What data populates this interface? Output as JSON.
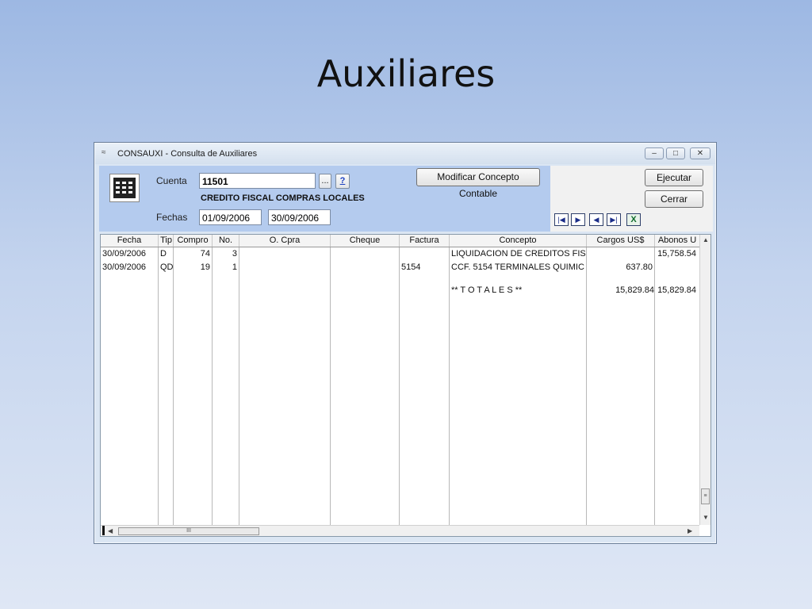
{
  "slide": {
    "title": "Auxiliares"
  },
  "window": {
    "title": "CONSAUXI - Consulta de Auxiliares",
    "controls": {
      "minimize": "–",
      "maximize": "□",
      "close": "✕"
    }
  },
  "form": {
    "cuenta_label": "Cuenta",
    "cuenta_value": "11501",
    "browse_label": "...",
    "help_label": "?",
    "cuenta_description": "CREDITO FISCAL COMPRAS LOCALES",
    "fechas_label": "Fechas",
    "fecha_desde": "01/09/2006",
    "fecha_hasta": "30/09/2006",
    "modificar_label": "Modificar Concepto Contable",
    "ejecutar_label": "Ejecutar",
    "cerrar_label": "Cerrar"
  },
  "nav": {
    "first": "|◀",
    "next": "▶",
    "prev": "◀",
    "last": "▶|",
    "excel": "X"
  },
  "table": {
    "headers": [
      "Fecha",
      "Tip",
      "Compro",
      "No.",
      "O. Cpra",
      "Cheque",
      "Factura",
      "Concepto",
      "Cargos US$",
      "Abonos U"
    ],
    "rows": [
      [
        "30/09/2006",
        "D",
        "74",
        "3",
        "",
        "",
        "",
        "LIQUIDACION DE CREDITOS FIS",
        "",
        "15,758.54"
      ],
      [
        "30/09/2006",
        "QD",
        "19",
        "1",
        "",
        "",
        "5154",
        "CCF. 5154 TERMINALES QUIMIC",
        "637.80",
        ""
      ]
    ],
    "totals": {
      "label": "** T O T A L E S **",
      "cargos": "15,829.84",
      "abonos": "15,829.84"
    }
  },
  "scroll": {
    "up": "▲",
    "down": "▼",
    "left": "◀",
    "right": "▶",
    "grip": "III"
  }
}
